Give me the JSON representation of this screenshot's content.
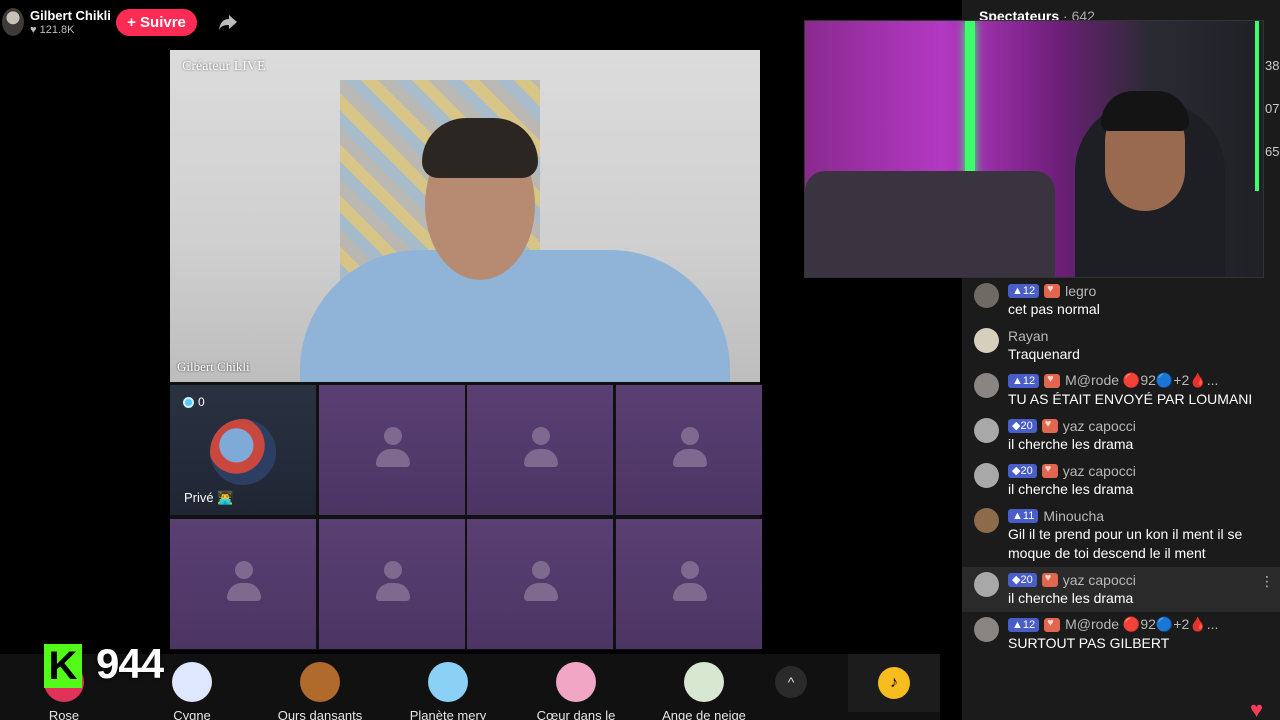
{
  "host": {
    "name": "Gilbert Chikli",
    "likes": "121.8K",
    "follow_label": "+ Suivre"
  },
  "stage": {
    "live_label": "Créateur LIVE",
    "guest_name": "Gilbert Chikli",
    "private_seat": {
      "count": "0",
      "label": "Privé 👨‍💻"
    }
  },
  "kick": {
    "badge": "K",
    "count": "944"
  },
  "gifts": [
    {
      "name": "Rose",
      "color": "#e0335a"
    },
    {
      "name": "Cygne",
      "color": "#dfe7ff"
    },
    {
      "name": "Ours dansants",
      "color": "#b06a2c"
    },
    {
      "name": "Planète mery",
      "color": "#8bd0f5"
    },
    {
      "name": "Cœur dans le",
      "color": "#f2a6c6"
    },
    {
      "name": "Ange de neige",
      "color": "#d8e8d0"
    }
  ],
  "gift_toggle": "^",
  "tiktok_coin": "♪",
  "panel": {
    "viewers_label": "Spectateurs",
    "viewers_count": "· 642",
    "side_numbers": [
      "38",
      "07",
      "65"
    ]
  },
  "chat": [
    {
      "level": "▲12",
      "heart": true,
      "user": "legro",
      "text": "cet pas normal"
    },
    {
      "level": "",
      "heart": false,
      "user": "Rayan",
      "text": "Traquenard"
    },
    {
      "level": "▲12",
      "heart": true,
      "user": "M@rode 🔴92🔵+2🩸...",
      "text": "TU AS ÉTAIT ENVOYÉ PAR LOUMANI"
    },
    {
      "level": "◆20",
      "heart": true,
      "user": "yaz capocci",
      "text": "il cherche les drama"
    },
    {
      "level": "◆20",
      "heart": true,
      "user": "yaz capocci",
      "text": "il cherche les drama"
    },
    {
      "level": "▲11",
      "heart": false,
      "user": "Minoucha",
      "text": "Gil il te prend pour un kon il ment il se moque de toi descend le il ment"
    },
    {
      "level": "◆20",
      "heart": true,
      "user": "yaz capocci",
      "text": "il cherche les drama",
      "highlight": true
    },
    {
      "level": "▲12",
      "heart": true,
      "user": "M@rode 🔴92🔵+2🩸...",
      "text": "SURTOUT PAS GILBERT"
    }
  ]
}
